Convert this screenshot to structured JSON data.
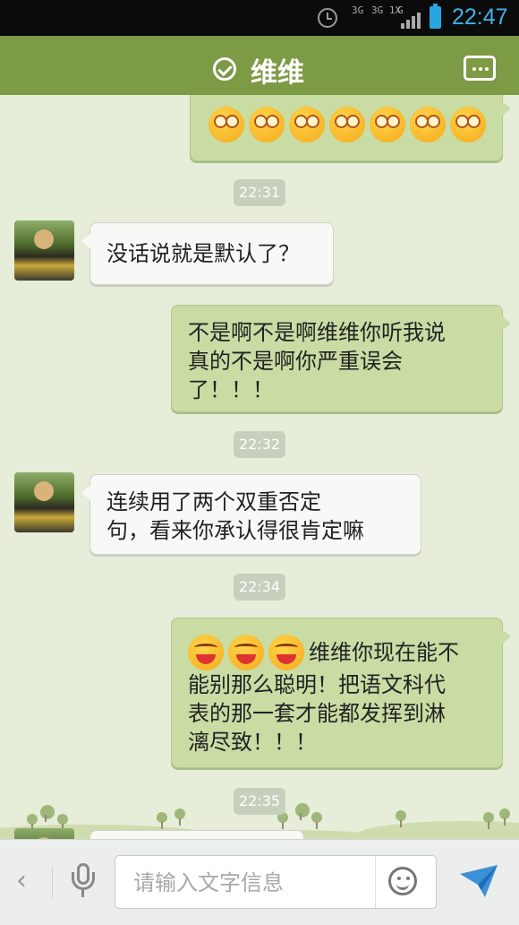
{
  "status_bar": {
    "network_left": "3G",
    "network_mid": "3G 1X",
    "network_right": "G",
    "time": "22:47"
  },
  "header": {
    "title": "维维"
  },
  "messages": [
    {
      "type": "emoji_row",
      "side": "out",
      "emoji": "dizzy",
      "count": 7
    },
    {
      "type": "time",
      "text": "22:31"
    },
    {
      "type": "text",
      "side": "in",
      "lines": [
        "没话说就是默认了？"
      ]
    },
    {
      "type": "text",
      "side": "out",
      "lines": [
        "不是啊不是啊维维你听我说",
        "真的不是啊你严重误会",
        "了！！！"
      ]
    },
    {
      "type": "time",
      "text": "22:32"
    },
    {
      "type": "text",
      "side": "in",
      "lines": [
        "连续用了两个双重否定",
        "句，看来你承认得很肯定嘛"
      ]
    },
    {
      "type": "time",
      "text": "22:34"
    },
    {
      "type": "text",
      "side": "out",
      "emoji": "laugh",
      "emoji_count": 3,
      "lines": [
        "维维你现在能不",
        "能别那么聪明！把语文科代",
        "表的那一套才能都发挥到淋",
        "漓尽致！！！"
      ]
    },
    {
      "type": "time",
      "text": "22:35"
    }
  ],
  "input_bar": {
    "placeholder": "请输入文字信息",
    "back_label": "‹"
  },
  "colors": {
    "header_green": "#7d9a45",
    "outgoing_bubble": "#c8dca4",
    "incoming_bubble": "#f8f8f6",
    "chat_background": "#e6edd9",
    "clock_blue": "#3fb3e8"
  },
  "icons": [
    "clock-icon",
    "signal-icon",
    "battery-icon",
    "check-icon",
    "more-icon",
    "back-icon",
    "mic-icon",
    "smile-icon",
    "send-icon"
  ]
}
